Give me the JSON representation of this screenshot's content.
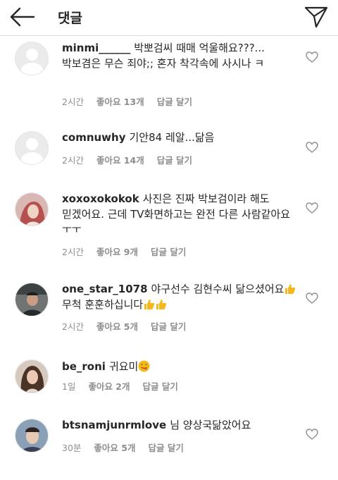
{
  "header": {
    "title": "댓글",
    "back_icon": "arrow-left-icon",
    "send_icon": "paper-plane-icon"
  },
  "comments": [
    {
      "username": "minmi______",
      "text": "박뽀검씨 때매 억울해요???...박보겸은 무슨 죄야;; 혼자 착각속에 사시나 ㅋ",
      "time": "2시간",
      "likes": "좋아요 13개",
      "reply": "답글 달기",
      "avatar": "default-avatar"
    },
    {
      "username": "comnuwhy",
      "text": "기안84 레알...닮음",
      "time": "2시간",
      "likes": "좋아요 14개",
      "reply": "답글 달기",
      "avatar": "default-avatar"
    },
    {
      "username": "xoxoxokokok",
      "text": "사진은 진짜 박보검이라 해도 믿겠어요. 근데 TV화면하고는 완전 다른 사람같아요 ㅜㅜ",
      "time": "2시간",
      "likes": "좋아요 9개",
      "reply": "답글 달기",
      "avatar": "photo-avatar"
    },
    {
      "username": "one_star_1078",
      "text_before": "야구선수 김현수씨 닮으셨어요",
      "text_middle": " 무척 훈훈하십니다",
      "time": "2시간",
      "likes": "좋아요 5개",
      "reply": "답글 달기",
      "avatar": "photo-avatar",
      "emoji": "thumbs-up-emoji"
    },
    {
      "username": "be_roni",
      "text": "귀요미",
      "time": "1일",
      "likes": "좋아요 2개",
      "reply": "답글 달기",
      "avatar": "photo-avatar",
      "emoji": "yum-face-emoji"
    },
    {
      "username": "btsnamjunrmlove",
      "text": "님 양상국닮았어요",
      "time": "30분",
      "likes": "좋아요 5개",
      "reply": "답글 달기",
      "avatar": "photo-avatar"
    }
  ],
  "colors": {
    "text": "#262626",
    "meta": "#8e8e8e",
    "divider": "#dbdbdb",
    "emoji_yellow": "#f5b81c"
  },
  "icons": [
    "arrow-left-icon",
    "paper-plane-icon",
    "heart-outline-icon"
  ]
}
